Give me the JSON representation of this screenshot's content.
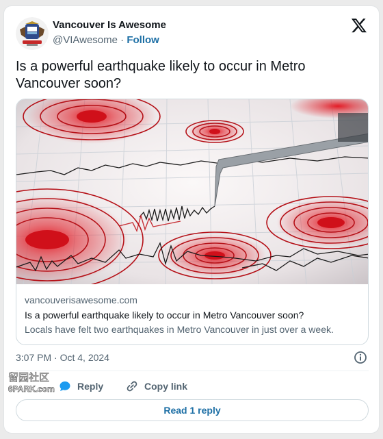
{
  "author": {
    "name": "Vancouver Is Awesome",
    "handle": "@VIAwesome",
    "separator": "·",
    "follow_label": "Follow"
  },
  "tweet": {
    "text": "Is a powerful earthquake likely to occur in Metro Vancouver soon?",
    "timestamp": "3:07 PM · Oct 4, 2024"
  },
  "link_card": {
    "domain": "vancouverisawesome.com",
    "title": "Is a powerful earthquake likely to occur in Metro Vancouver soon?",
    "description": "Locals have felt two earthquakes in Metro Vancouver in just over a week."
  },
  "actions": {
    "reply_label": "Reply",
    "copy_link_label": "Copy link",
    "read_replies_label": "Read 1 reply"
  },
  "watermark": {
    "chinese": "留园社区",
    "site": "6PARK.com"
  },
  "icons": {
    "platform": "x-logo-icon",
    "info": "info-icon",
    "reply": "reply-bubble-icon",
    "copy": "link-icon"
  },
  "colors": {
    "link_blue": "#1d6fa5",
    "muted_text": "#536471",
    "border": "#cfd9de",
    "reply_icon_blue": "#1d9bf0"
  }
}
